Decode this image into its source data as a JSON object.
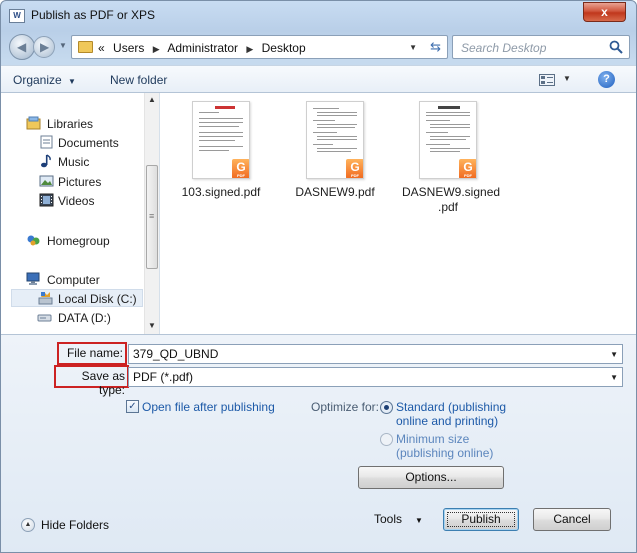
{
  "window": {
    "title": "Publish as PDF or XPS",
    "close_label": "x"
  },
  "address": {
    "prefix": "«",
    "crumbs": [
      "Users",
      "Administrator",
      "Desktop"
    ]
  },
  "search": {
    "placeholder": "Search Desktop"
  },
  "toolbar": {
    "organize_label": "Organize",
    "new_folder_label": "New folder",
    "help_label": "?"
  },
  "navpane": {
    "items": [
      {
        "label": "Libraries",
        "icon": "libraries-icon"
      },
      {
        "label": "Documents",
        "icon": "documents-icon"
      },
      {
        "label": "Music",
        "icon": "music-icon"
      },
      {
        "label": "Pictures",
        "icon": "pictures-icon"
      },
      {
        "label": "Videos",
        "icon": "videos-icon"
      },
      {
        "label": "Homegroup",
        "icon": "homegroup-icon"
      },
      {
        "label": "Computer",
        "icon": "computer-icon"
      },
      {
        "label": "Local Disk (C:)",
        "icon": "local-disk-icon"
      },
      {
        "label": "DATA (D:)",
        "icon": "drive-icon"
      }
    ]
  },
  "files": [
    {
      "name": "103.signed.pdf"
    },
    {
      "name": "DASNEW9.pdf"
    },
    {
      "name": "DASNEW9.signed .pdf"
    }
  ],
  "form": {
    "file_name_label": "File name:",
    "file_name_value": "379_QD_UBND",
    "save_type_label": "Save as type:",
    "save_type_value": "PDF (*.pdf)",
    "open_after_label": "Open file after publishing",
    "open_after_checked": true,
    "optimize_label": "Optimize for:",
    "optimize_options": [
      {
        "label": "Standard (publishing online and printing)",
        "selected": true
      },
      {
        "label": "Minimum size (publishing online)",
        "selected": false
      }
    ],
    "options_button": "Options..."
  },
  "footer": {
    "hide_folders_label": "Hide Folders",
    "tools_label": "Tools",
    "publish_button": "Publish",
    "cancel_button": "Cancel"
  },
  "colors": {
    "highlight_box": "#cc2222",
    "link": "#1d5aa8",
    "pdf_badge": "#f0681e"
  }
}
